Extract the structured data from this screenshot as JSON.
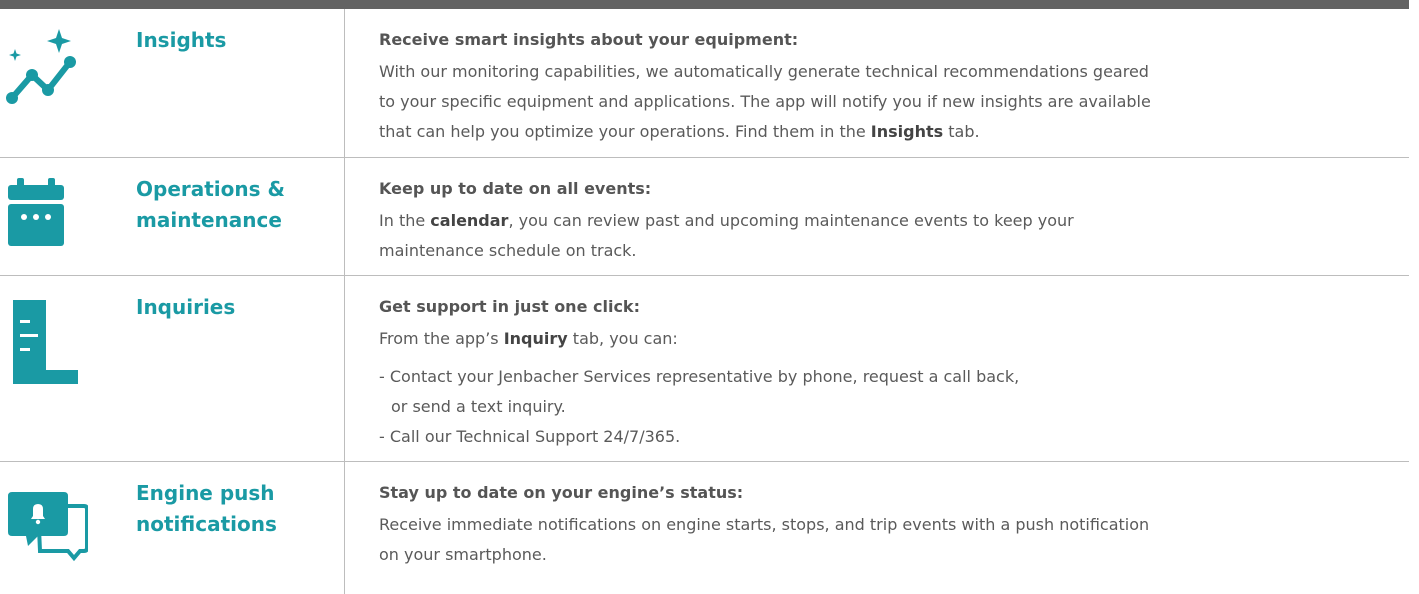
{
  "rows": [
    {
      "icon": "insights-chart-icon",
      "title": "Insights",
      "heading": "Receive smart insights about your equipment:",
      "body_lines": [
        "With our monitoring capabilities, we automatically generate technical recommendations geared",
        "to your specific equipment and applications. The app will notify you if new insights are available"
      ],
      "last_line_before": "that can help you optimize your operations. Find them in the ",
      "last_line_bold": "Insights",
      "last_line_after": " tab."
    },
    {
      "icon": "calendar-icon",
      "title_line1": "Operations &",
      "title_line2": "maintenance",
      "heading": "Keep up to date on all events:",
      "line1_before": "In the ",
      "line1_bold": "calendar",
      "line1_after": ", you can review past and upcoming maintenance events to keep your",
      "line2": "maintenance schedule on track."
    },
    {
      "icon": "document-icon",
      "title": "Inquiries",
      "heading": "Get support in just one click:",
      "line1_before": "From the app’s ",
      "line1_bold": "Inquiry",
      "line1_after": " tab, you can:",
      "bullet1_line1": "- Contact your Jenbacher Services representative by phone, request a call back,",
      "bullet1_line2": "or send a text inquiry.",
      "bullet2": "- Call our Technical Support 24/7/365."
    },
    {
      "icon": "chat-notification-icon",
      "title_line1": "Engine push",
      "title_line2": "notifications",
      "heading": "Stay up to date on your engine’s status:",
      "line1": "Receive immediate notifications on engine starts, stops, and trip events with a push notification",
      "line2": "on your smartphone."
    }
  ],
  "colors": {
    "accent": "#1a9aa4",
    "text": "#5a5a5a",
    "divider": "#bdbdbd",
    "topbar": "#636363"
  }
}
